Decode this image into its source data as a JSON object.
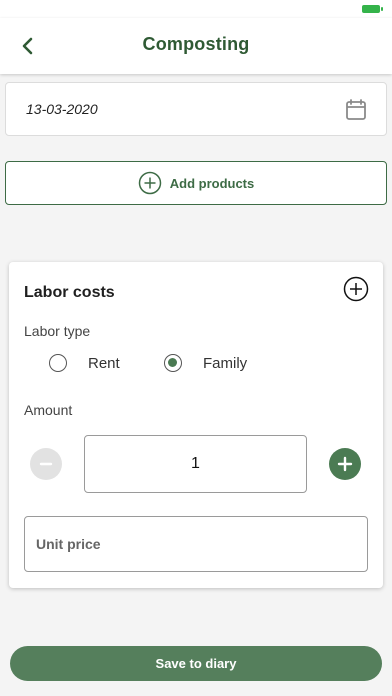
{
  "header": {
    "title": "Composting",
    "back_icon": "chevron-left-icon"
  },
  "date_field": {
    "value": "13-03-2020",
    "icon": "calendar-icon"
  },
  "add_products": {
    "label": "Add products",
    "icon": "plus-circle-icon"
  },
  "labor_card": {
    "title": "Labor costs",
    "add_icon": "plus-circle-icon",
    "labor_type_label": "Labor type",
    "options": [
      {
        "label": "Rent",
        "selected": false
      },
      {
        "label": "Family",
        "selected": true
      }
    ],
    "amount_label": "Amount",
    "amount_value": "1",
    "unit_price_placeholder": "Unit price"
  },
  "save_button": {
    "label": "Save to diary"
  },
  "colors": {
    "brand_green": "#2f5a34",
    "button_green": "#557f5c",
    "battery_green": "#34b34a"
  }
}
